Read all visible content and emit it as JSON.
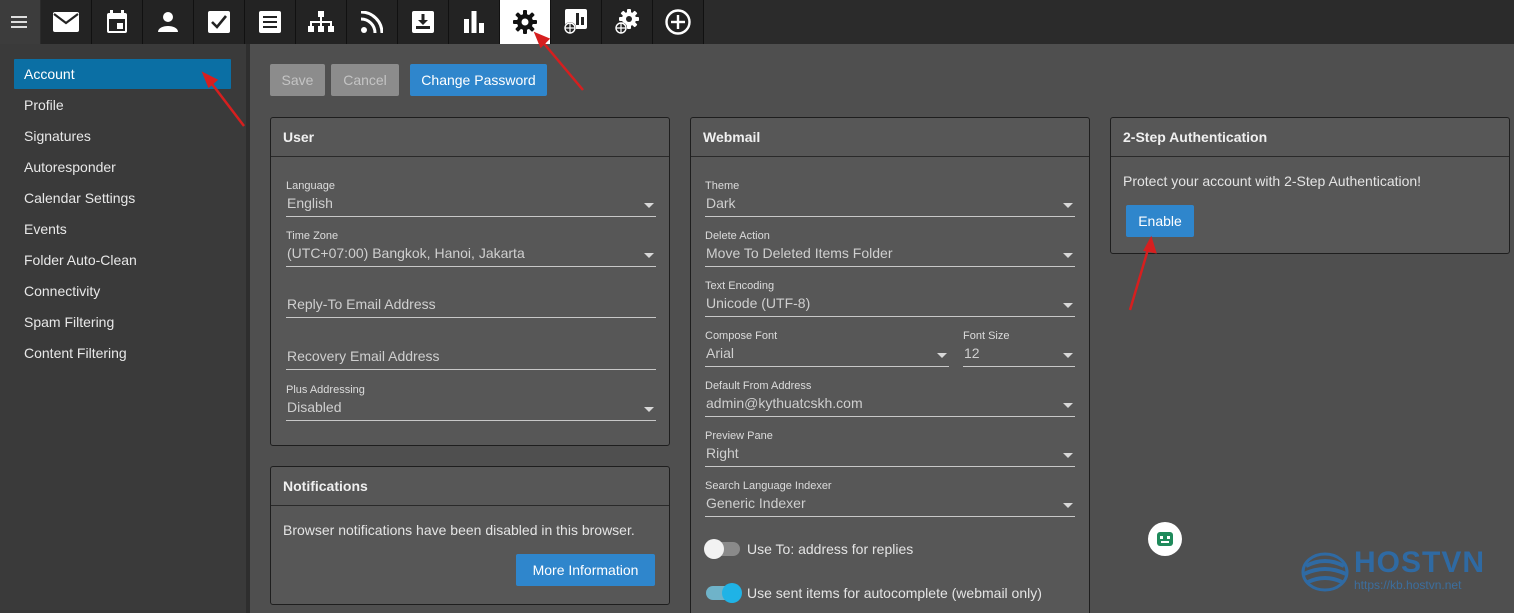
{
  "toolbar": {
    "icons": [
      "menu-icon",
      "mail-icon",
      "calendar-icon",
      "contacts-icon",
      "tasks-icon",
      "notes-icon",
      "domain-tree-icon",
      "rss-icon",
      "download-icon",
      "reports-icon",
      "settings-icon",
      "domain-reports-icon",
      "domain-settings-icon",
      "add-icon"
    ],
    "active": "settings-icon"
  },
  "sidebar": {
    "items": [
      {
        "label": "Account",
        "active": true
      },
      {
        "label": "Profile"
      },
      {
        "label": "Signatures"
      },
      {
        "label": "Autoresponder"
      },
      {
        "label": "Calendar Settings"
      },
      {
        "label": "Events"
      },
      {
        "label": "Folder Auto-Clean"
      },
      {
        "label": "Connectivity"
      },
      {
        "label": "Spam Filtering"
      },
      {
        "label": "Content Filtering"
      }
    ]
  },
  "actions": {
    "save": "Save",
    "cancel": "Cancel",
    "change_password": "Change Password"
  },
  "user": {
    "title": "User",
    "language_label": "Language",
    "language_value": "English",
    "timezone_label": "Time Zone",
    "timezone_value": "(UTC+07:00) Bangkok, Hanoi, Jakarta",
    "reply_to_placeholder": "Reply-To Email Address",
    "recovery_placeholder": "Recovery Email Address",
    "plus_label": "Plus Addressing",
    "plus_value": "Disabled"
  },
  "notifications": {
    "title": "Notifications",
    "message": "Browser notifications have been disabled in this browser.",
    "more_info": "More Information"
  },
  "webmail": {
    "title": "Webmail",
    "theme_label": "Theme",
    "theme_value": "Dark",
    "delete_label": "Delete Action",
    "delete_value": "Move To Deleted Items Folder",
    "encoding_label": "Text Encoding",
    "encoding_value": "Unicode (UTF-8)",
    "font_label": "Compose Font",
    "font_value": "Arial",
    "fontsize_label": "Font Size",
    "fontsize_value": "12",
    "from_label": "Default From Address",
    "from_value": "admin@kythuatcskh.com",
    "preview_label": "Preview Pane",
    "preview_value": "Right",
    "indexer_label": "Search Language Indexer",
    "indexer_value": "Generic Indexer",
    "toggle1_label": "Use To: address for replies",
    "toggle1_on": false,
    "toggle2_label": "Use sent items for autocomplete (webmail only)",
    "toggle2_on": true
  },
  "twostep": {
    "title": "2-Step Authentication",
    "message": "Protect your account with 2-Step Authentication!",
    "enable": "Enable"
  },
  "watermark": {
    "brand": "HOSTVN",
    "url": "https://kb.hostvn.net"
  },
  "colors": {
    "accent": "#2f86cc",
    "active_nav": "#0b6fa4",
    "annotation_arrow": "#d61f1f"
  }
}
